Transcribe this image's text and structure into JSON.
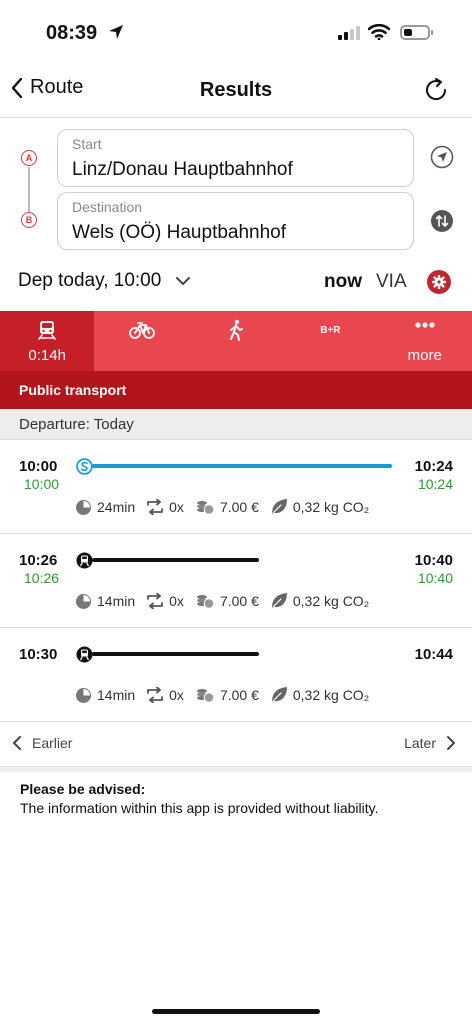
{
  "status_bar": {
    "time": "08:39"
  },
  "nav": {
    "back_label": "Route",
    "title": "Results"
  },
  "stations": {
    "start_label": "Start",
    "start_value": "Linz/Donau Hauptbahnhof",
    "start_badge": "A",
    "destination_label": "Destination",
    "destination_value": "Wels (OÖ) Hauptbahnhof",
    "destination_badge": "B"
  },
  "date_row": {
    "departure": "Dep today, 10:00",
    "now": "now",
    "via": "VIA"
  },
  "modes": [
    {
      "icon": "train-icon",
      "label": "0:14h",
      "active": true
    },
    {
      "icon": "bicycle-icon",
      "label": "",
      "active": false
    },
    {
      "icon": "walking-icon",
      "label": "",
      "active": false
    },
    {
      "icon": "b-r-icon",
      "text": "B+R",
      "label": "",
      "active": false
    },
    {
      "icon": "more-dots-icon",
      "label": "more",
      "active": false
    }
  ],
  "section_title": "Public transport",
  "departure_bar": "Departure: Today",
  "connections": [
    {
      "dep": "10:00",
      "dep_rt": "10:00",
      "arr": "10:24",
      "arr_rt": "10:24",
      "mode": "s-bahn",
      "line_color": "#1a9ad6",
      "duration": "24min",
      "changes": "0x",
      "price": "7.00 €",
      "co2": "0,32 kg CO₂"
    },
    {
      "dep": "10:26",
      "dep_rt": "10:26",
      "arr": "10:40",
      "arr_rt": "10:40",
      "mode": "train",
      "line_color": "#111111",
      "duration": "14min",
      "changes": "0x",
      "price": "7.00 €",
      "co2": "0,32 kg CO₂"
    },
    {
      "dep": "10:30",
      "dep_rt": "",
      "arr": "10:44",
      "arr_rt": "",
      "mode": "train",
      "line_color": "#111111",
      "duration": "14min",
      "changes": "0x",
      "price": "7.00 €",
      "co2": "0,32 kg CO₂"
    }
  ],
  "pager": {
    "earlier": "Earlier",
    "later": "Later"
  },
  "advice": {
    "heading": "Please be advised:",
    "text": "The information within this app is provided without liability."
  },
  "colors": {
    "brand_red": "#e9474f",
    "active_red": "#c51f28",
    "bar_red": "#b3151d",
    "realtime_green": "#2e9a2e",
    "sbahn_blue": "#1a9ad6"
  }
}
